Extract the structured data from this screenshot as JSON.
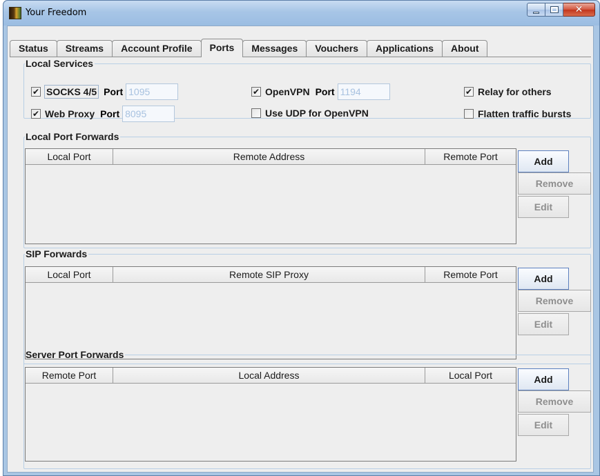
{
  "window": {
    "title": "Your Freedom"
  },
  "tabs": [
    {
      "label": "Status"
    },
    {
      "label": "Streams"
    },
    {
      "label": "Account Profile"
    },
    {
      "label": "Ports",
      "active": true
    },
    {
      "label": "Messages"
    },
    {
      "label": "Vouchers"
    },
    {
      "label": "Applications"
    },
    {
      "label": "About"
    }
  ],
  "local_services": {
    "legend": "Local Services",
    "socks": {
      "label": "SOCKS 4/5",
      "checked": true,
      "port_label": "Port",
      "port_value": "1095"
    },
    "web_proxy": {
      "label": "Web Proxy",
      "checked": true,
      "port_label": "Port",
      "port_value": "8095"
    },
    "openvpn": {
      "label": "OpenVPN",
      "checked": true,
      "port_label": "Port",
      "port_value": "1194"
    },
    "udp_openvpn": {
      "label": "Use UDP for OpenVPN",
      "checked": false
    },
    "relay": {
      "label": "Relay for others",
      "checked": true
    },
    "flatten": {
      "label": "Flatten traffic bursts",
      "checked": false
    }
  },
  "local_port_forwards": {
    "legend": "Local Port Forwards",
    "columns": [
      "Local Port",
      "Remote Address",
      "Remote Port"
    ],
    "rows": [],
    "buttons": {
      "add": "Add",
      "remove": "Remove",
      "edit": "Edit"
    }
  },
  "sip_forwards": {
    "legend": "SIP Forwards",
    "columns": [
      "Local Port",
      "Remote SIP Proxy",
      "Remote Port"
    ],
    "rows": [],
    "buttons": {
      "add": "Add",
      "remove": "Remove",
      "edit": "Edit"
    }
  },
  "server_port_forwards": {
    "legend": "Server Port Forwards",
    "columns": [
      "Remote Port",
      "Local Address",
      "Local Port"
    ],
    "rows": [],
    "buttons": {
      "add": "Add",
      "remove": "Remove",
      "edit": "Edit"
    }
  },
  "icons": {
    "app": "your-freedom-app-icon",
    "check": "✔",
    "minimize": "minimize-icon",
    "maximize": "maximize-icon",
    "close": "close-icon"
  }
}
